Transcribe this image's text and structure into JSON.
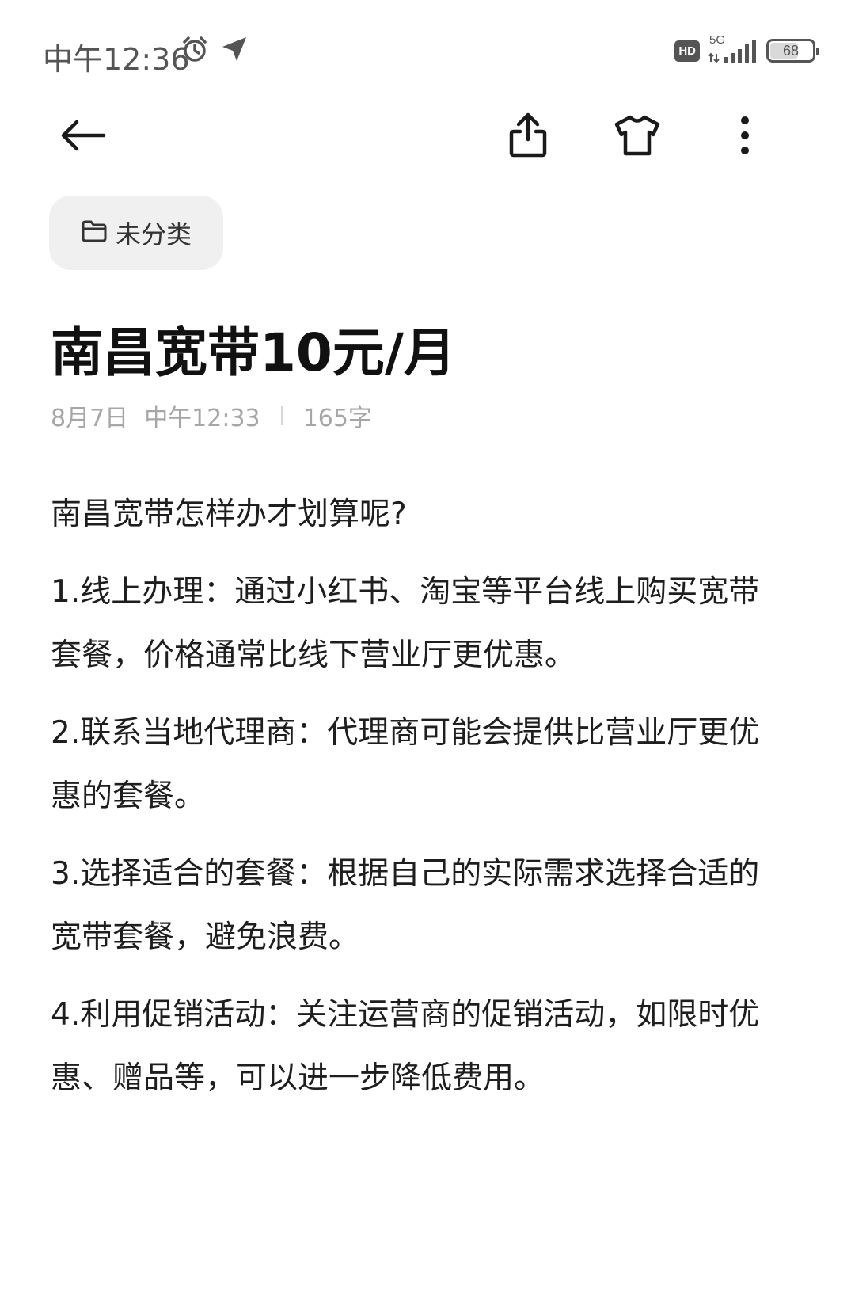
{
  "status_bar": {
    "time": "中午12:36",
    "icons_left": [
      "alarm-clock-icon",
      "location-arrow-icon"
    ],
    "hd_label": "HD",
    "network_label": "5G",
    "battery_level": "68",
    "battery_percent": 68
  },
  "toolbar": {
    "back_icon": "arrow-left-icon",
    "share_icon": "share-icon",
    "theme_icon": "tshirt-icon",
    "more_icon": "more-vertical-icon"
  },
  "category": {
    "icon": "folder-icon",
    "label": "未分类"
  },
  "note": {
    "title": "南昌宽带10元/月",
    "date": "8月7日",
    "time": "中午12:33",
    "word_count": "165字",
    "paragraphs": [
      "南昌宽带怎样办才划算呢?",
      "1.线上办理：通过小红书、淘宝等平台线上购买宽带套餐，价格通常比线下营业厅更优惠。",
      "2.联系当地代理商：代理商可能会提供比营业厅更优惠的套餐。",
      "3.选择适合的套餐：根据自己的实际需求选择合适的宽带套餐，避免浪费。",
      "4.利用促销活动：关注运营商的促销活动，如限时优惠、赠品等，可以进一步降低费用。"
    ]
  },
  "colors": {
    "text_primary": "#111111",
    "text_meta": "#a6a6a6",
    "chip_bg": "#f0f0f0",
    "status_gray": "#555555"
  }
}
